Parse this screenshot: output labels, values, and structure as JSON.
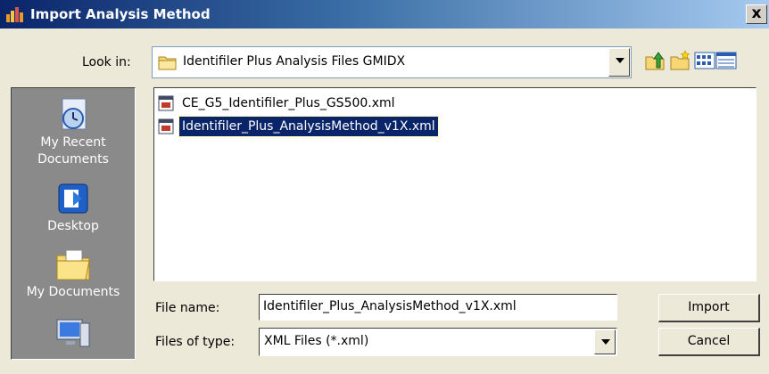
{
  "window": {
    "title": "Import Analysis Method",
    "close_label": "x"
  },
  "lookin": {
    "label": "Look in:",
    "value": "Identifiler Plus Analysis Files GMIDX"
  },
  "places": [
    {
      "label": "My Recent Documents",
      "icon": "clock-document-icon"
    },
    {
      "label": "Desktop",
      "icon": "desktop-icon"
    },
    {
      "label": "My Documents",
      "icon": "folder-documents-icon"
    },
    {
      "label": "",
      "icon": "my-computer-icon"
    }
  ],
  "files": [
    {
      "name": "CE_G5_Identifiler_Plus_GS500.xml",
      "selected": false
    },
    {
      "name": "Identifiler_Plus_AnalysisMethod_v1X.xml",
      "selected": true
    }
  ],
  "filename": {
    "label": "File name:",
    "value": "Identifiler_Plus_AnalysisMethod_v1X.xml"
  },
  "filetype": {
    "label": "Files of type:",
    "value": "XML Files (*.xml)"
  },
  "buttons": {
    "import": "Import",
    "cancel": "Cancel"
  },
  "colors": {
    "title_bar": "#0a246a",
    "dialog_bg": "#ece9d8",
    "places_bg": "#8a8a8a",
    "selection": "#0a246a"
  }
}
